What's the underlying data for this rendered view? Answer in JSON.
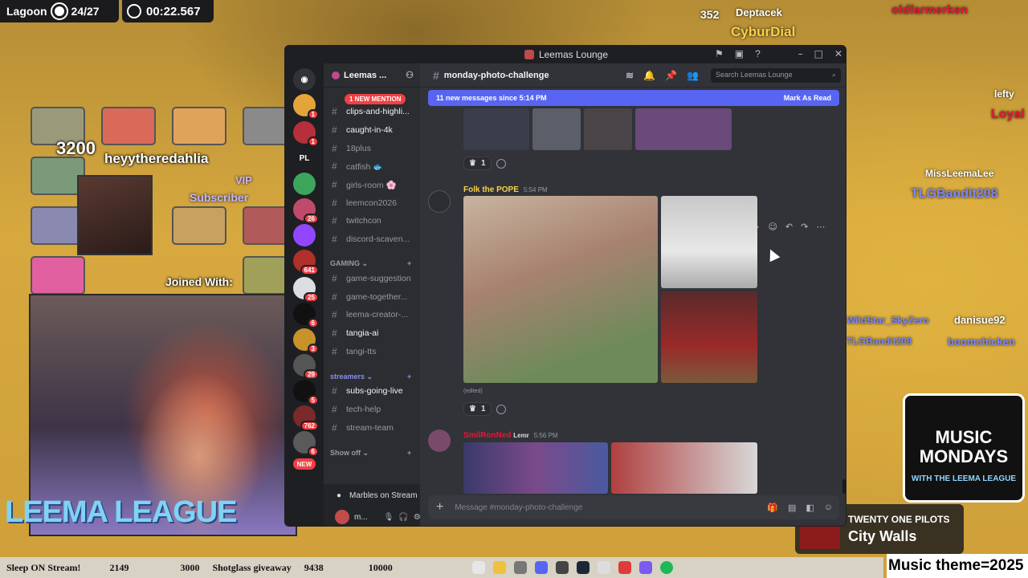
{
  "overlay": {
    "lagoon_label": "Lagoon",
    "lagoon_count": "24/27",
    "timer": "00:22.567",
    "sub_count": "3200",
    "sub_name": "heyytheredahlia",
    "vip": "VIP",
    "subscriber": "Subscriber",
    "joined": "Joined With:",
    "brand": "LEEMA LEAGUE",
    "music_title": "MUSIC MONDAYS",
    "music_sub": "WITH THE LEEMA LEAGUE",
    "np_artist": "TWENTY ONE PILOTS",
    "np_song": "City Walls",
    "theme": "Music theme=2025",
    "chat_names": [
      {
        "name": "oldfarmerken",
        "color": "#e0193a"
      },
      {
        "name": "Deptacek",
        "color": "#ffffff"
      },
      {
        "name": "CyburDial",
        "color": "#f6d24a"
      },
      {
        "name": "lefty",
        "color": "#ffffff"
      },
      {
        "name": "Loyal",
        "color": "#e0193a"
      },
      {
        "name": "MissLeemaLee",
        "color": "#ffffff"
      },
      {
        "name": "TLGBandit208",
        "color": "#7a86ff"
      },
      {
        "name": "WildStar_SkyZero",
        "color": "#7a86ff"
      },
      {
        "name": "danisue92",
        "color": "#ffffff"
      },
      {
        "name": "TLGBandit208",
        "color": "#7a86ff"
      },
      {
        "name": "boomchicken",
        "color": "#7a86ff"
      }
    ],
    "cyb_count": "352"
  },
  "ticker": {
    "items": [
      "Sleep ON Stream!",
      "2149",
      "3000",
      "Shotglass giveaway",
      "9438",
      "10000"
    ]
  },
  "discord": {
    "window_title": "Leemas Lounge",
    "server": "Leemas ...",
    "new_mention": "1 NEW MENTION",
    "guilds_label": "PL",
    "guild_badges": [
      "1",
      "1",
      "26",
      "641",
      "25",
      "6",
      "3",
      "29",
      "5",
      "762",
      "6"
    ],
    "guild_new": "NEW",
    "channels": [
      {
        "name": "clips-and-highli...",
        "unread": true
      },
      {
        "name": "caught-in-4k",
        "unread": true
      },
      {
        "name": "18plus",
        "unread": false
      },
      {
        "name": "catfish 🐟",
        "unread": false
      },
      {
        "name": "girls-room 🌸",
        "unread": false
      },
      {
        "name": "leemcon2026",
        "unread": false
      },
      {
        "name": "twitchcon",
        "unread": false
      },
      {
        "name": "discord-scaven...",
        "unread": false
      }
    ],
    "cat_gaming": "GAMING",
    "gaming_channels": [
      {
        "name": "game-suggestion",
        "unread": false
      },
      {
        "name": "game-together...",
        "unread": false
      },
      {
        "name": "leema-creator-...",
        "unread": false
      },
      {
        "name": "tangia-ai",
        "unread": true
      },
      {
        "name": "tangi-tts",
        "unread": false
      }
    ],
    "cat_streamers": "streamers",
    "streamer_channels": [
      {
        "name": "subs-going-live",
        "unread": true
      },
      {
        "name": "tech-help",
        "unread": false
      },
      {
        "name": "stream-team",
        "unread": false
      }
    ],
    "show_off": "Show off",
    "voice": "Marbles on Stream",
    "user": "m...",
    "channel": "monday-photo-challenge",
    "search_placeholder": "Search Leemas Lounge",
    "new_messages": "11 new messages since 5:14 PM",
    "mark_read": "Mark As Read",
    "react_count_1": "1",
    "msg1_author": "Folk the POPE",
    "msg1_time": "5:54 PM",
    "msg1_edited": "(edited)",
    "react_count_2": "1",
    "msg2_author": "SmilRonNed",
    "msg2_tag": "Lemr",
    "msg2_time": "5:56 PM",
    "composer_placeholder": "Message #monday-photo-challenge"
  }
}
